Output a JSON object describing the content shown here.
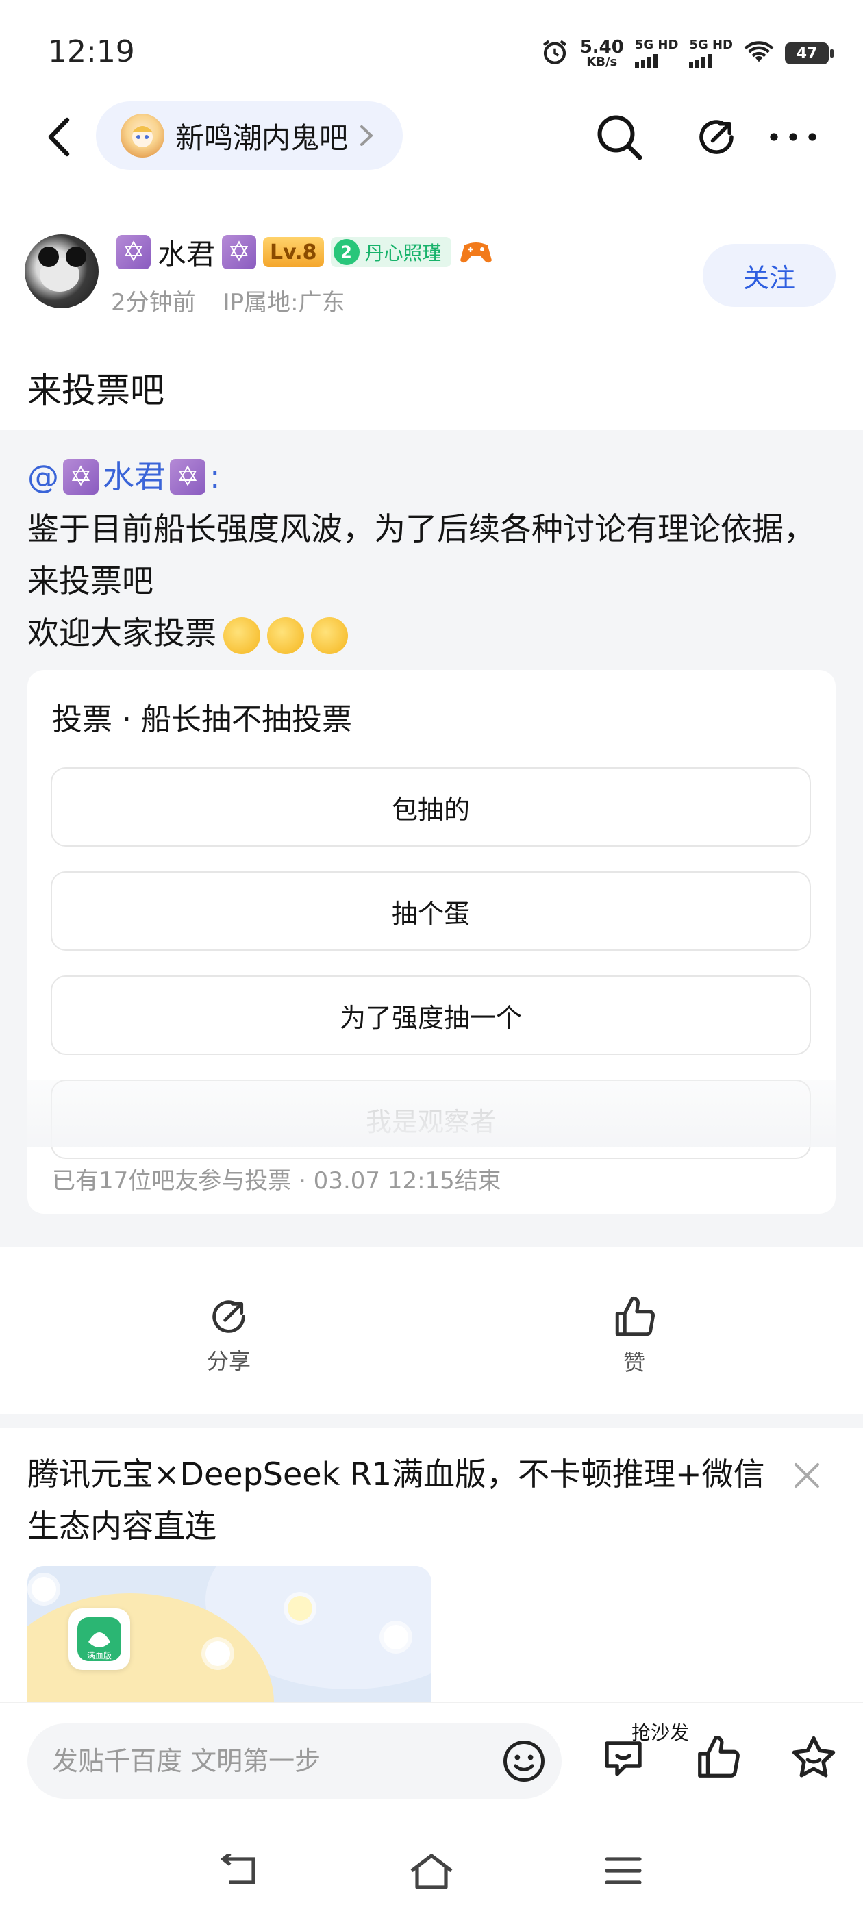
{
  "status_bar": {
    "time": "12:19",
    "net_speed": "5.40",
    "net_unit": "KB/s",
    "sim1": "5G HD",
    "sim2": "5G HD",
    "battery": "47"
  },
  "nav": {
    "forum_name": "新鸣潮内鬼吧",
    "icons": [
      "back-icon",
      "search-icon",
      "share-icon",
      "more-icon"
    ]
  },
  "author": {
    "name": "水君",
    "level": "Lv.8",
    "honor_level": "2",
    "honor_title": "丹心照瑾",
    "time": "2分钟前",
    "ip": "IP属地:广东",
    "follow_label": "关注"
  },
  "post": {
    "title": "来投票吧",
    "repost_author": "@",
    "repost_author_name": "水君",
    "repost_colon": ":",
    "body_line1": "鉴于目前船长强度风波，为了后续各种讨论有理论依据，来投票吧",
    "body_line2": "欢迎大家投票"
  },
  "vote": {
    "title": "投票 · 船长抽不抽投票",
    "options": [
      "包抽的",
      "抽个蛋",
      "为了强度抽一个",
      "我是观察者"
    ],
    "footer": "已有17位吧友参与投票 · 03.07 12:15结束"
  },
  "actions": {
    "share_label": "分享",
    "like_label": "赞"
  },
  "ad": {
    "text": "腾讯元宝×DeepSeek R1满血版，不卡顿推理+微信生态内容直连",
    "app_badge": "满血版"
  },
  "comment_bar": {
    "placeholder": "发贴千百度 文明第一步",
    "sofa_label": "抢沙发"
  },
  "colors": {
    "accent_blue": "#2f5fe0",
    "link_blue": "#3a64d8",
    "honor_green": "#17b26a",
    "level_gold": "#f4a62c",
    "page_bg_gray": "#f4f5f7"
  }
}
